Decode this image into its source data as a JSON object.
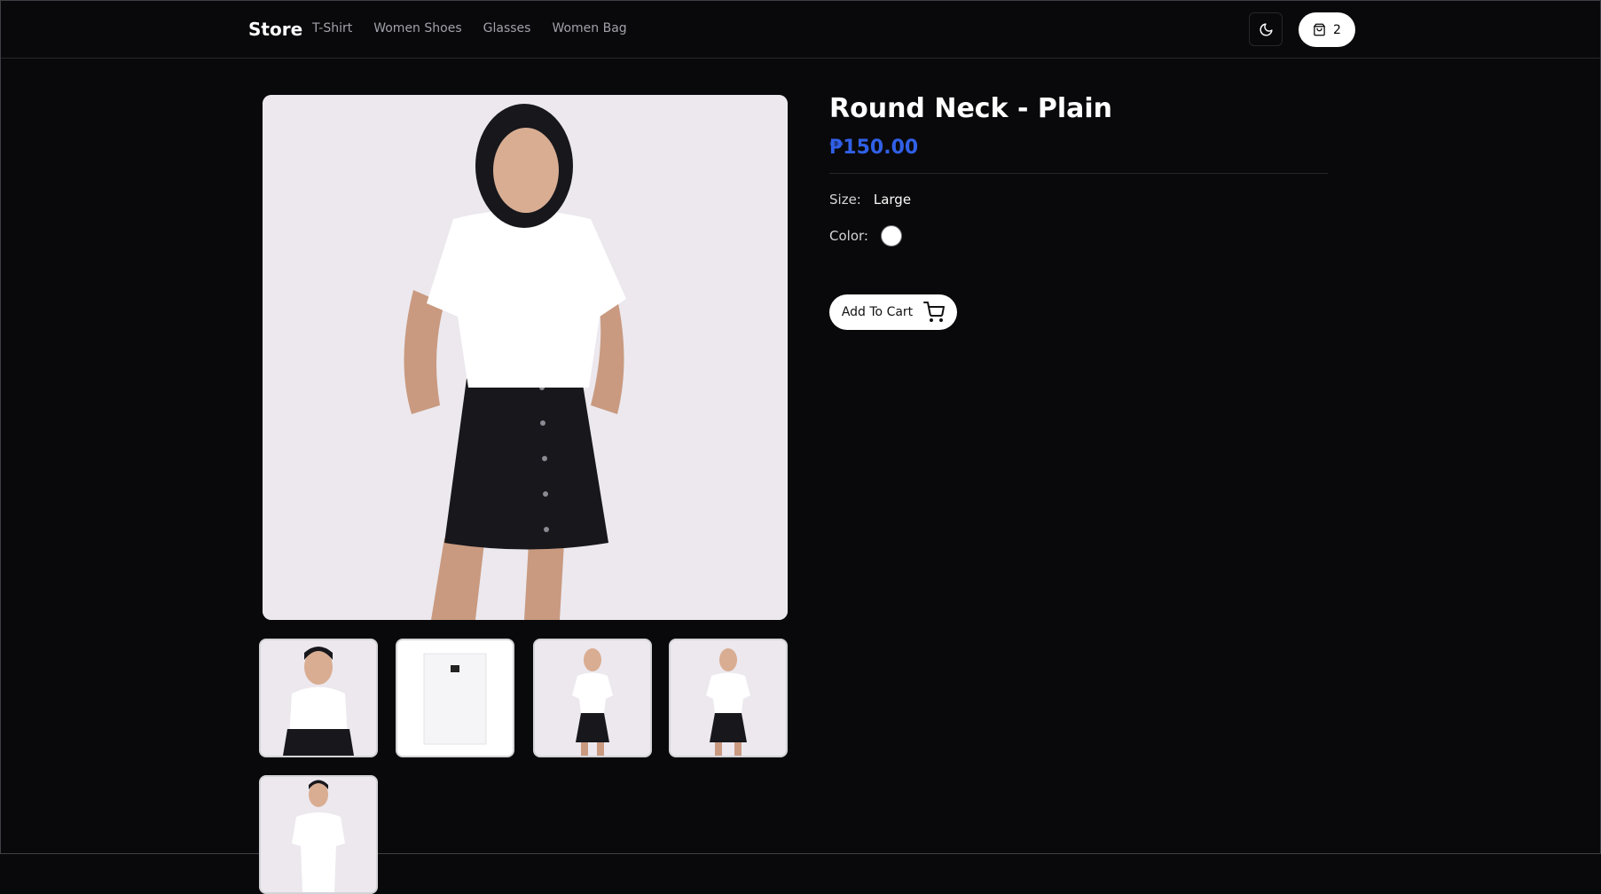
{
  "header": {
    "brand": "Store",
    "nav": [
      "T-Shirt",
      "Women Shoes",
      "Glasses",
      "Women Bag"
    ],
    "cart_count": "2",
    "theme_icon": "moon-icon",
    "cart_icon": "shopping-bag-icon"
  },
  "product": {
    "title": "Round Neck - Plain",
    "price": "₱150.00",
    "size_label": "Size:",
    "size_value": "Large",
    "color_label": "Color:",
    "color_value": "#ffffff",
    "add_to_cart": "Add To Cart"
  },
  "gallery": {
    "thumbnail_count": 5
  },
  "colors": {
    "background": "#09090b",
    "price": "#3160e6",
    "border": "#27272a"
  }
}
